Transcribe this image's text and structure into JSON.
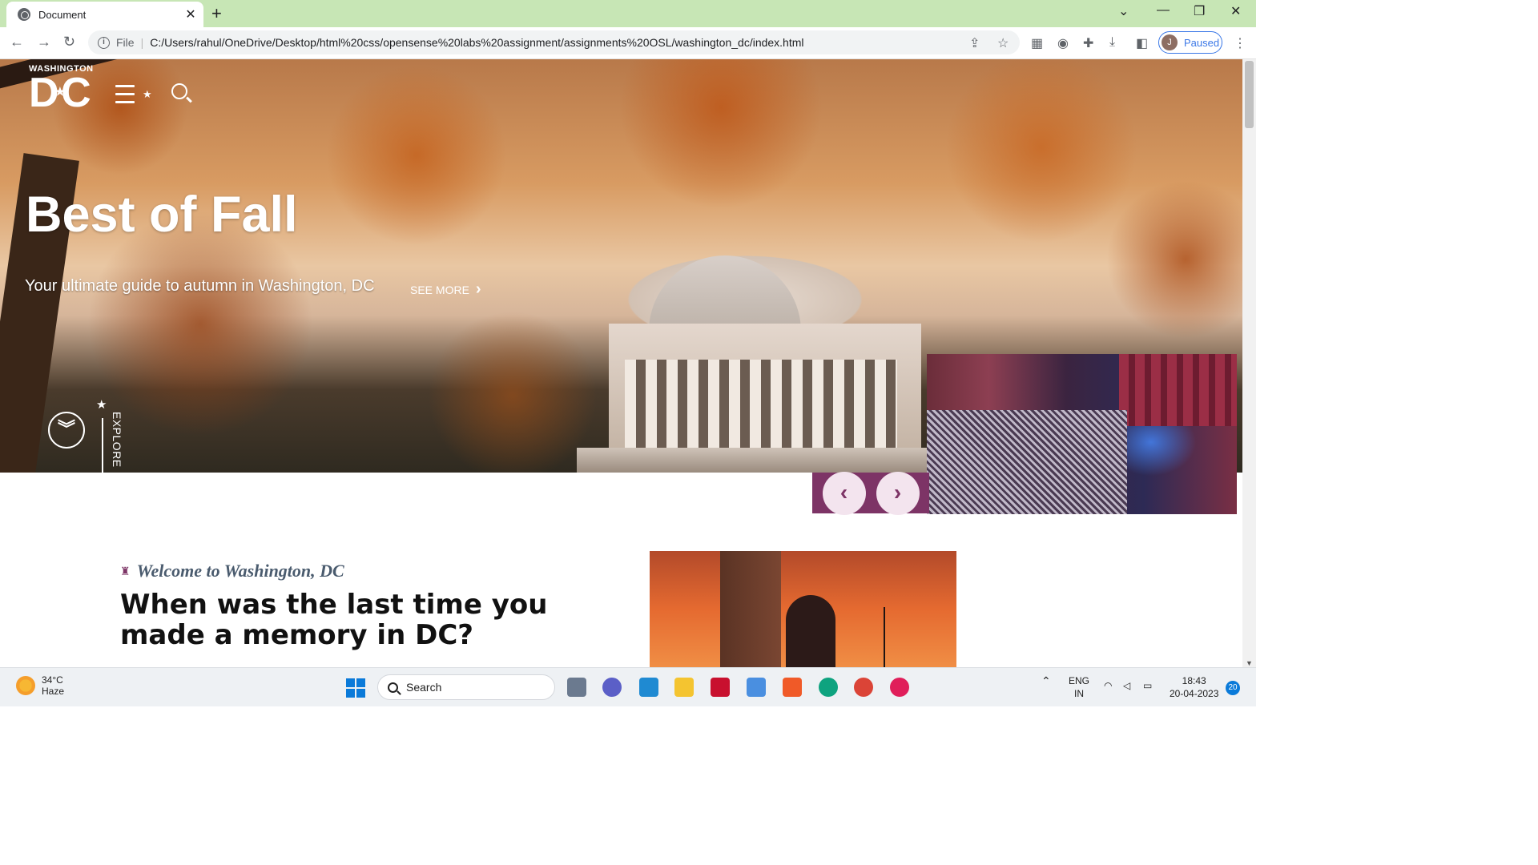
{
  "browser": {
    "tab_title": "Document",
    "tab_close": "✕",
    "new_tab": "+",
    "address_prefix": "File",
    "address_url": "C:/Users/rahul/OneDrive/Desktop/html%20css/opensense%20labs%20assignment/assignments%20OSL/washington_dc/index.html",
    "profile_initial": "J",
    "profile_status": "Paused"
  },
  "site": {
    "logo_small": "WASHINGTON",
    "logo_big_left": "D",
    "logo_big_right": "C",
    "hero_title": "Best of Fall",
    "hero_subtitle": "Your ultimate guide to autumn in Washington, DC",
    "see_more": "SEE MORE",
    "explore": "EXPLORE",
    "welcome": "Welcome to Washington, DC",
    "heading": "When was the last time you made a memory in DC?"
  },
  "taskbar": {
    "temperature": "34°C",
    "condition": "Haze",
    "search_label": "Search",
    "lang_top": "ENG",
    "lang_bottom": "IN",
    "time": "18:43",
    "date": "20-04-2023",
    "notifications": "20"
  },
  "colors": {
    "accent_purple": "#7d3466",
    "tab_strip": "#c7e6b5",
    "welcome_text": "#4a5b6e"
  }
}
